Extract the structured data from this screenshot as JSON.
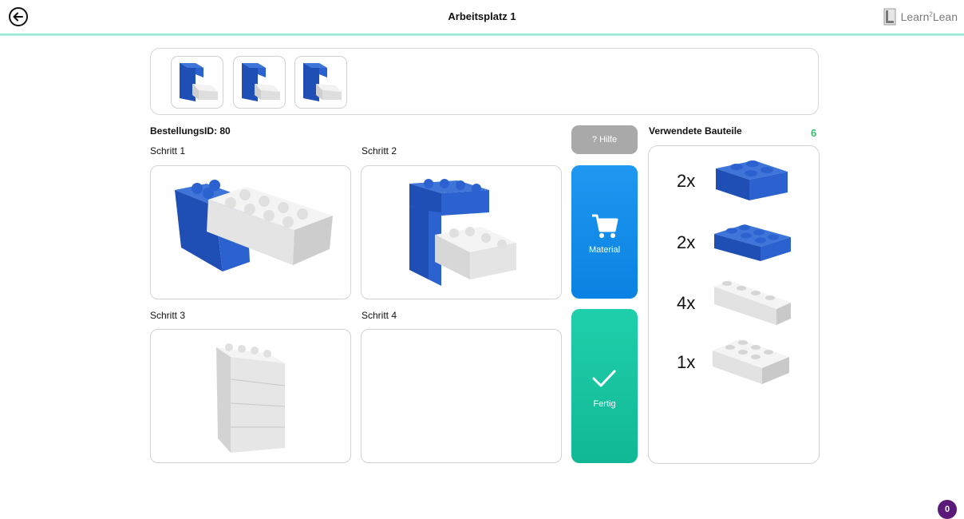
{
  "header": {
    "title": "Arbeitsplatz 1",
    "logo_text": "Learn",
    "logo_sup": "2",
    "logo_text2": "Lean"
  },
  "order": {
    "id_label": "BestellungsID: 80"
  },
  "steps": [
    {
      "label": "Schritt 1"
    },
    {
      "label": "Schritt 2"
    },
    {
      "label": "Schritt 3"
    },
    {
      "label": "Schritt 4"
    }
  ],
  "actions": {
    "help_label": "? Hilfe",
    "material_label": "Material",
    "done_label": "Fertig"
  },
  "parts": {
    "title": "Verwendete Bauteile",
    "count": "6",
    "items": [
      {
        "qty": "2x",
        "color": "blue"
      },
      {
        "qty": "2x",
        "color": "blue"
      },
      {
        "qty": "4x",
        "color": "white"
      },
      {
        "qty": "1x",
        "color": "white"
      }
    ]
  },
  "notification_count": "0",
  "colors": {
    "accent_line": "#7fe3cf",
    "material_blue": "#0a82e3",
    "done_green": "#12b896",
    "help_gray": "#a9a9a9",
    "count_green": "#2fc26b",
    "badge_purple": "#5c1a78",
    "brick_blue": "#1f4fb4",
    "brick_white": "#e2e2e2"
  }
}
